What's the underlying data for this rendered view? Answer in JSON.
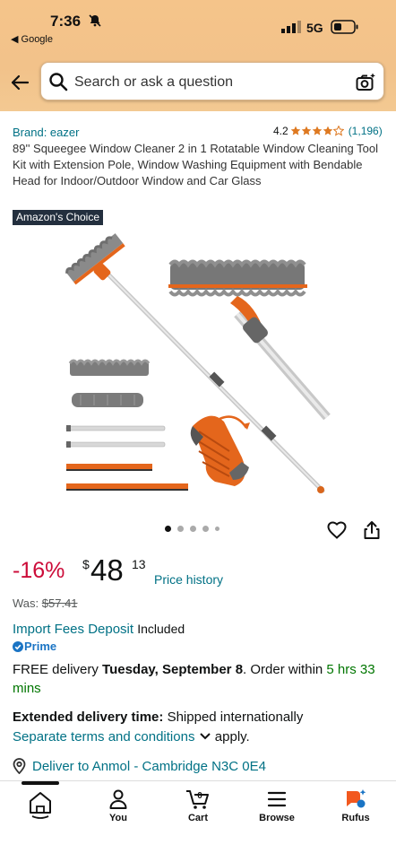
{
  "status_bar": {
    "time": "7:36",
    "back_app": "Google",
    "network": "5G"
  },
  "search": {
    "placeholder": "Search or ask a question"
  },
  "product": {
    "brand": "Brand: eazer",
    "rating_value": "4.2",
    "rating_count": "(1,196)",
    "stars": 4.2,
    "title": "89'' Squeegee Window Cleaner 2 in 1 Rotatable Window Cleaning Tool Kit with Extension Pole, Window Washing Equipment with Bendable Head for Indoor/Outdoor Window and Car Glass",
    "badge": "Amazon's Choice",
    "image_count": 5,
    "active_image": 1
  },
  "pricing": {
    "discount": "-16%",
    "currency": "$",
    "whole": "48",
    "fraction": "13",
    "history_link": "Price history",
    "was_label": "Was:",
    "was_price": "$57.41"
  },
  "fees": {
    "link": "Import Fees Deposit",
    "included": "Included"
  },
  "prime": {
    "label": "Prime"
  },
  "delivery": {
    "prefix": "FREE delivery ",
    "date": "Tuesday, September 8",
    "middle": ". Order within ",
    "time_left": "5 hrs 33 mins"
  },
  "extended": {
    "label": "Extended delivery time:",
    "text": " Shipped internationally",
    "terms_link": "Separate terms and conditions",
    "suffix": " apply."
  },
  "deliver_to": "Deliver to Anmol - Cambridge N3C 0E4",
  "nav": {
    "home": "",
    "you": "You",
    "cart": "Cart",
    "cart_count": "0",
    "browse": "Browse",
    "rufus": "Rufus"
  },
  "colors": {
    "header": "#f3c48c",
    "link": "#007185",
    "discount": "#cc0c39",
    "star": "#de7921",
    "choice_bg": "#232f3e",
    "prime": "#1a74c4",
    "in_time": "#007600"
  }
}
